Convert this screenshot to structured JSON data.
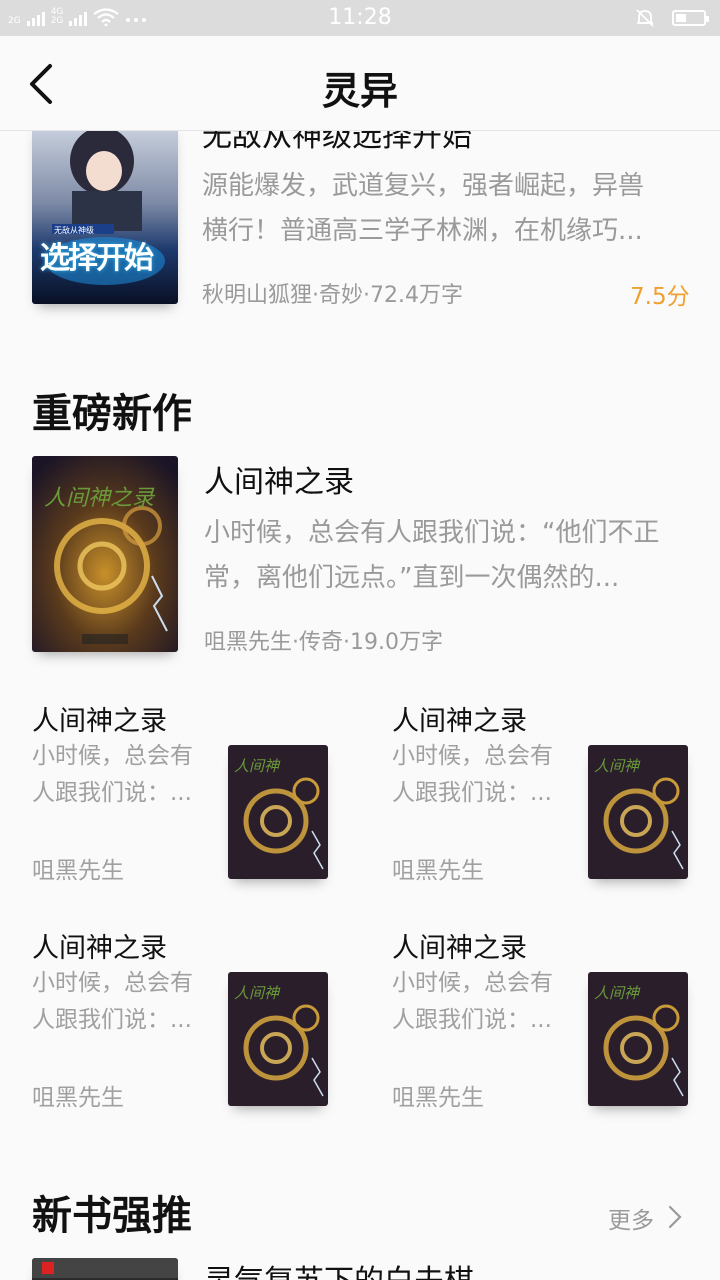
{
  "status": {
    "time": "11:28",
    "net1": "2G",
    "net2": "4G",
    "net3": "2G"
  },
  "header": {
    "title": "灵异"
  },
  "top_book": {
    "title": "无敌从神级选择开始",
    "desc_line1": "源能爆发，武道复兴，强者崛起，异兽",
    "desc_line2": "横行！普通高三学子林渊，在机缘巧...",
    "meta": "秋明山狐狸·奇妙·72.4万字",
    "score": "7.5分",
    "cover_text": "选择开始",
    "cover_badge": "无敌从神级"
  },
  "section1": {
    "title": "重磅新作"
  },
  "featured": {
    "title": "人间神之录",
    "desc_line1": "小时候，总会有人跟我们说：“他们不正",
    "desc_line2": "常，离他们远点。”直到一次偶然的...",
    "meta": "咀黑先生·传奇·19.0万字",
    "cover_text": "人间神之录"
  },
  "grid": [
    {
      "title": "人间神之录",
      "desc1": "小时候，总会有",
      "desc2": "人跟我们说：...",
      "author": "咀黑先生"
    },
    {
      "title": "人间神之录",
      "desc1": "小时候，总会有",
      "desc2": "人跟我们说：...",
      "author": "咀黑先生"
    },
    {
      "title": "人间神之录",
      "desc1": "小时候，总会有",
      "desc2": "人跟我们说：...",
      "author": "咀黑先生"
    },
    {
      "title": "人间神之录",
      "desc1": "小时候，总会有",
      "desc2": "人跟我们说：...",
      "author": "咀黑先生"
    }
  ],
  "section2": {
    "title": "新书强推",
    "more": "更多"
  },
  "bottom_book": {
    "title": "灵气复苏下的白夫棋"
  },
  "colors": {
    "accent": "#f0a030",
    "text": "#222222",
    "muted": "#9a9a9a"
  }
}
